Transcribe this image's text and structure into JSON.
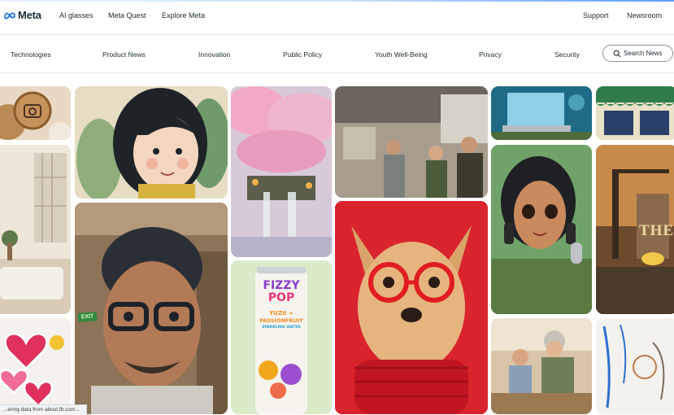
{
  "top_nav": {
    "brand": "Meta",
    "links": [
      "AI glasses",
      "Meta Quest",
      "Explore Meta"
    ],
    "right_links": [
      "Support",
      "Newsroom"
    ]
  },
  "sub_nav": {
    "links": [
      "Technologies",
      "Product News",
      "Innovation",
      "Public Policy",
      "Youth Well-Being",
      "Privacy",
      "Security"
    ],
    "search_label": "Search News"
  },
  "tiles": {
    "can_brand_line1": "FIZZY",
    "can_brand_line2": "POP",
    "can_flavor_line1": "YUZU +",
    "can_flavor_line2": "PASSIONFRUIT",
    "can_subtitle": "SPARKLING WATER",
    "poster_text": "THE",
    "exit_sign": "EXIT"
  },
  "status_bar": "...ering data from about.fb.com...",
  "colors": {
    "brand_blue": "#0668e1",
    "text": "#1c2b33",
    "dog_background": "#d9242e",
    "can_background": "#d9ebc8"
  }
}
